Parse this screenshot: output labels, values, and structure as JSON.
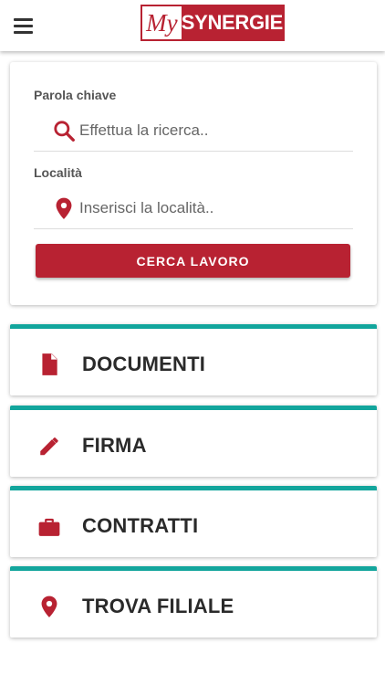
{
  "header": {
    "menu_icon": "hamburger-menu-icon",
    "logo_prefix": "My",
    "logo_brand": "SYNERGIE"
  },
  "search": {
    "keyword_label": "Parola chiave",
    "keyword_placeholder": "Effettua la ricerca..",
    "keyword_icon": "search-icon",
    "location_label": "Località",
    "location_placeholder": "Inserisci la località..",
    "location_icon": "location-pin-icon",
    "button_label": "CERCA LAVORO"
  },
  "menu": {
    "items": [
      {
        "label": "DOCUMENTI",
        "icon": "document-icon"
      },
      {
        "label": "FIRMA",
        "icon": "pencil-icon"
      },
      {
        "label": "CONTRATTI",
        "icon": "briefcase-icon"
      },
      {
        "label": "TROVA FILIALE",
        "icon": "location-pin-icon"
      }
    ]
  },
  "colors": {
    "brand_red": "#b82232",
    "accent_teal": "#12a59c",
    "text_dark": "#2a2a2a",
    "label_gray": "#555555"
  }
}
